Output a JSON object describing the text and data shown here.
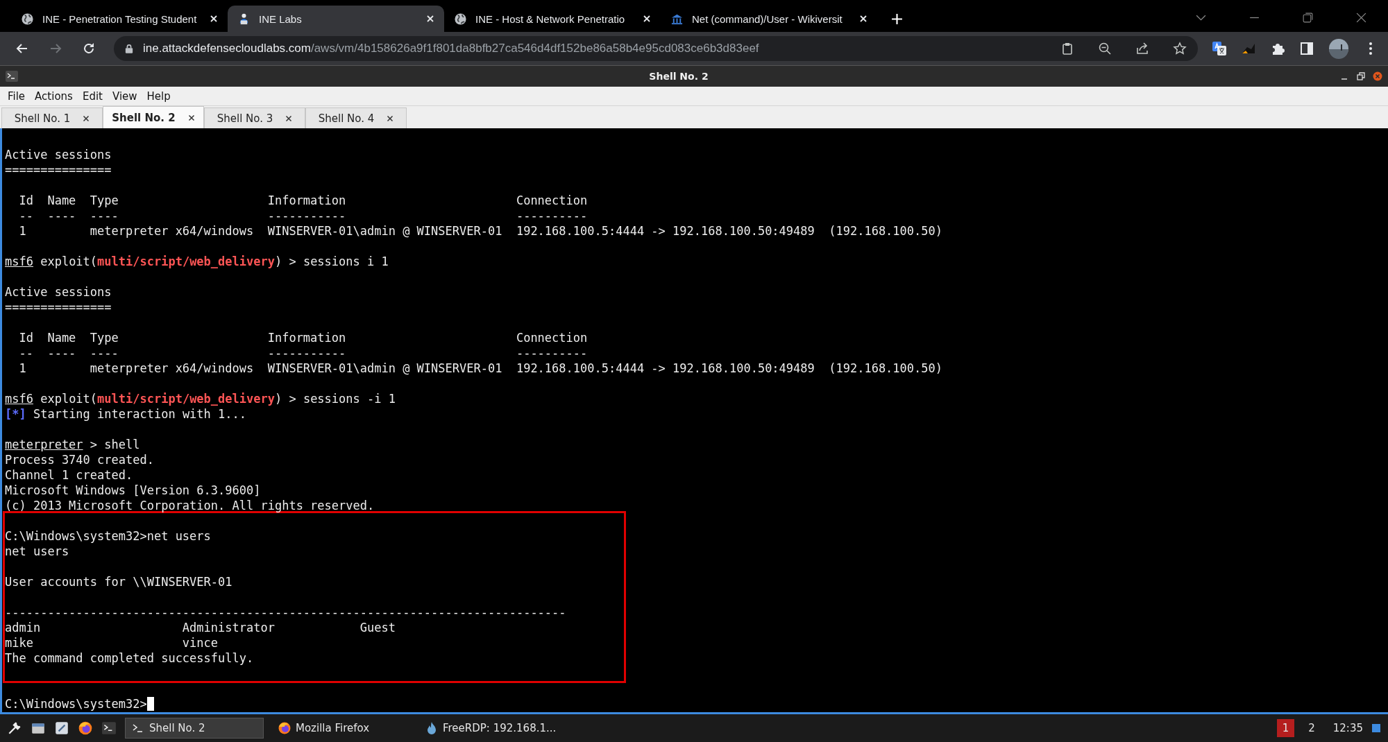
{
  "browser": {
    "tabs": [
      {
        "title": "INE - Penetration Testing Student",
        "kind": "globe",
        "selected": false
      },
      {
        "title": "INE Labs",
        "kind": "laptop",
        "selected": true
      },
      {
        "title": "INE - Host & Network Penetratio",
        "kind": "globe",
        "selected": false
      },
      {
        "title": "Net (command)/User - Wikiversit",
        "kind": "columns",
        "selected": false
      }
    ],
    "url": {
      "host": "ine.attackdefensecloudlabs.com",
      "path": "/aws/vm/4b158626a9f1f801da8bfb27ca546d4df152be86a58b4e95cd083ce6b3d83eef"
    }
  },
  "window": {
    "title": "Shell No. 2"
  },
  "menu": [
    "File",
    "Actions",
    "Edit",
    "View",
    "Help"
  ],
  "shell_tabs": [
    {
      "label": "Shell No. 1",
      "selected": false
    },
    {
      "label": "Shell No. 2",
      "selected": true
    },
    {
      "label": "Shell No. 3",
      "selected": false
    },
    {
      "label": "Shell No. 4",
      "selected": false
    }
  ],
  "terminal": {
    "blocks": [
      {
        "lines": [
          {
            "text": "Active sessions"
          },
          {
            "text": "==============="
          }
        ]
      },
      {
        "lines": [
          {
            "text": "  Id  Name  Type                     Information                        Connection"
          },
          {
            "text": "  --  ----  ----                     -----------                        ----------"
          },
          {
            "text": "  1         meterpreter x64/windows  WINSERVER-01\\admin @ WINSERVER-01  192.168.100.5:4444 -> 192.168.100.50:49489  (192.168.100.50)"
          }
        ]
      },
      {
        "lines": [
          {
            "segments": [
              {
                "text": "msf6",
                "kind": "prompt"
              },
              {
                "text": " exploit(",
                "kind": "plain"
              },
              {
                "text": "multi/script/web_delivery",
                "kind": "module"
              },
              {
                "text": ") > sessions i 1",
                "kind": "plain"
              }
            ]
          }
        ]
      },
      {
        "lines": [
          {
            "text": "Active sessions"
          },
          {
            "text": "==============="
          }
        ]
      },
      {
        "lines": [
          {
            "text": "  Id  Name  Type                     Information                        Connection"
          },
          {
            "text": "  --  ----  ----                     -----------                        ----------"
          },
          {
            "text": "  1         meterpreter x64/windows  WINSERVER-01\\admin @ WINSERVER-01  192.168.100.5:4444 -> 192.168.100.50:49489  (192.168.100.50)"
          }
        ]
      },
      {
        "lines": [
          {
            "segments": [
              {
                "text": "msf6",
                "kind": "prompt"
              },
              {
                "text": " exploit(",
                "kind": "plain"
              },
              {
                "text": "multi/script/web_delivery",
                "kind": "module"
              },
              {
                "text": ") > sessions -i 1",
                "kind": "plain"
              }
            ]
          },
          {
            "segments": [
              {
                "text": "[*]",
                "kind": "info"
              },
              {
                "text": " Starting interaction with 1...",
                "kind": "plain"
              }
            ]
          }
        ]
      },
      {
        "lines": [
          {
            "segments": [
              {
                "text": "meterpreter",
                "kind": "prompt"
              },
              {
                "text": " > shell",
                "kind": "plain"
              }
            ]
          },
          {
            "text": "Process 3740 created."
          },
          {
            "text": "Channel 1 created."
          },
          {
            "text": "Microsoft Windows [Version 6.3.9600]"
          },
          {
            "text": "(c) 2013 Microsoft Corporation. All rights reserved."
          }
        ]
      }
    ],
    "highlight": [
      {
        "lines": [
          {
            "text": "C:\\Windows\\system32>net users"
          },
          {
            "text": "net users"
          }
        ]
      },
      {
        "lines": [
          {
            "text": "User accounts for \\\\WINSERVER-01"
          }
        ]
      },
      {
        "lines": [
          {
            "text": "-------------------------------------------------------------------------------"
          },
          {
            "text": "admin                    Administrator            Guest"
          },
          {
            "text": "mike                     vince"
          },
          {
            "text": "The command completed successfully."
          }
        ]
      }
    ],
    "after": [
      {
        "lines": [
          {
            "text": "C:\\Windows\\system32>",
            "cursor": true
          }
        ]
      }
    ]
  },
  "taskbar": {
    "tasks": [
      {
        "label": "Shell No. 2",
        "kind": "terminal",
        "selected": true
      },
      {
        "label": "Mozilla Firefox",
        "kind": "firefox",
        "selected": false
      },
      {
        "label": "FreeRDP: 192.168.1...",
        "kind": "freerdp",
        "selected": false
      }
    ],
    "workspaces": [
      {
        "label": "1",
        "selected": true
      },
      {
        "label": "2",
        "selected": false
      }
    ],
    "clock": "12:35"
  }
}
